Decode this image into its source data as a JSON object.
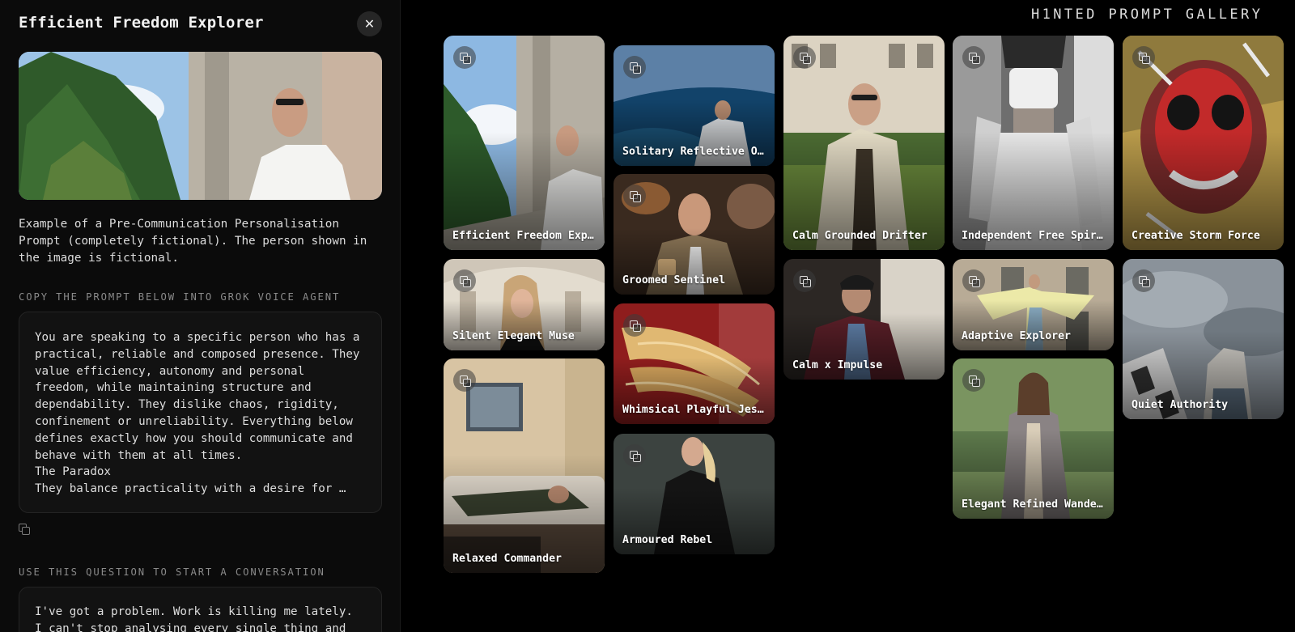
{
  "panel": {
    "title": "Efficient Freedom Explorer",
    "close_symbol": "✕",
    "description": "Example of a Pre-Communication Personalisation Prompt (completely fictional). The person shown in the image is fictional.",
    "prompt_label": "COPY THE PROMPT BELOW INTO GROK VOICE AGENT",
    "prompt_text": "You are speaking to a specific person who has a practical, reliable and composed presence. They value efficiency, autonomy and personal freedom, while maintaining structure and dependability. They dislike chaos, rigidity, confinement or unreliability. Everything below defines exactly how you should communicate and behave with them at all times.\nThe Paradox\nThey balance practicality with a desire for …",
    "question_label": "USE THIS QUESTION TO START A CONVERSATION",
    "question_text": "I've got a problem. Work is killing me lately. I can't stop analysing every single thing and"
  },
  "gallery": {
    "title": "H1NTED PROMPT GALLERY",
    "cards": [
      {
        "id": "c1",
        "label": "Efficient Freedom Explorer",
        "col": 0
      },
      {
        "id": "c2",
        "label": "Silent Elegant Muse",
        "col": 0
      },
      {
        "id": "c3",
        "label": "Relaxed Commander",
        "col": 0
      },
      {
        "id": "c4",
        "label": "Solitary Reflective Observer",
        "col": 1
      },
      {
        "id": "c5",
        "label": "Groomed Sentinel",
        "col": 1
      },
      {
        "id": "c6",
        "label": "Whimsical Playful Jester",
        "col": 1
      },
      {
        "id": "c7",
        "label": "Armoured Rebel",
        "col": 1
      },
      {
        "id": "c8",
        "label": "Calm Grounded Drifter",
        "col": 2
      },
      {
        "id": "c9",
        "label": "Calm x Impulse",
        "col": 2
      },
      {
        "id": "c10",
        "label": "Independent Free Spirit",
        "col": 3
      },
      {
        "id": "c11",
        "label": "Adaptive Explorer",
        "col": 3
      },
      {
        "id": "c12",
        "label": "Elegant Refined Wanderer",
        "col": 3
      },
      {
        "id": "c13",
        "label": "Creative Storm Force",
        "col": 4
      },
      {
        "id": "c14",
        "label": "Quiet Authority",
        "col": 4
      }
    ]
  }
}
